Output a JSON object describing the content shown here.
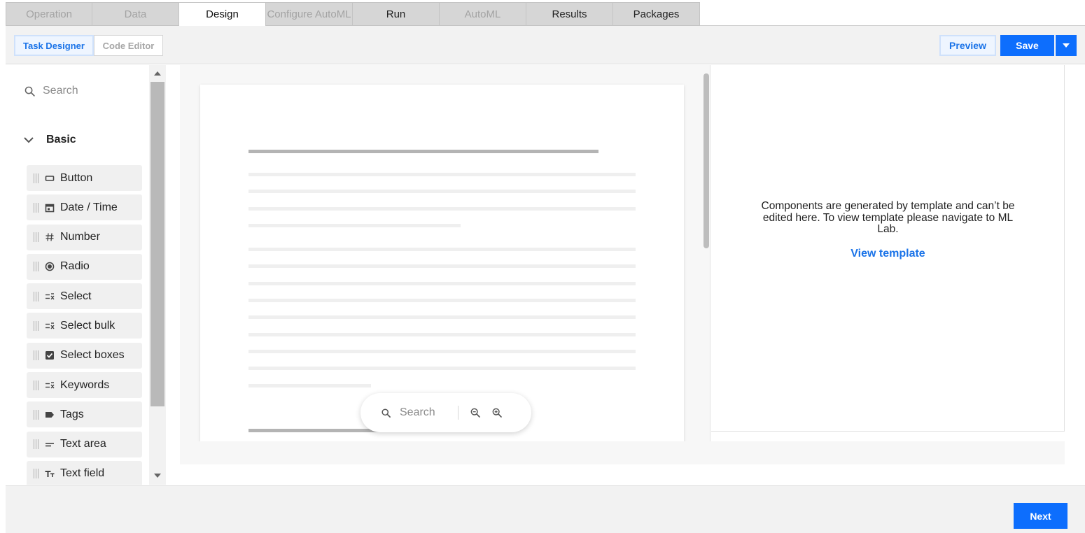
{
  "tabs": [
    {
      "label": "Operation",
      "state": "disabled"
    },
    {
      "label": "Data",
      "state": "disabled"
    },
    {
      "label": "Design",
      "state": "active"
    },
    {
      "label": "Configure AutoML",
      "state": "disabled"
    },
    {
      "label": "Run",
      "state": "normal"
    },
    {
      "label": "AutoML",
      "state": "disabled"
    },
    {
      "label": "Results",
      "state": "normal"
    },
    {
      "label": "Packages",
      "state": "normal"
    }
  ],
  "toolbar": {
    "task_designer_label": "Task Designer",
    "code_editor_label": "Code Editor",
    "preview_label": "Preview",
    "save_label": "Save"
  },
  "sidebar": {
    "search_placeholder": "Search",
    "group_label": "Basic",
    "items": [
      {
        "label": "Button",
        "icon": "button-icon"
      },
      {
        "label": "Date / Time",
        "icon": "calendar-icon"
      },
      {
        "label": "Number",
        "icon": "hash-icon"
      },
      {
        "label": "Radio",
        "icon": "radio-icon"
      },
      {
        "label": "Select",
        "icon": "select-icon"
      },
      {
        "label": "Select bulk",
        "icon": "select-icon"
      },
      {
        "label": "Select boxes",
        "icon": "checkbox-icon"
      },
      {
        "label": "Keywords",
        "icon": "select-icon"
      },
      {
        "label": "Tags",
        "icon": "tag-icon"
      },
      {
        "label": "Text area",
        "icon": "text-area-icon"
      },
      {
        "label": "Text field",
        "icon": "text-field-icon"
      }
    ]
  },
  "canvas": {
    "search_label": "Search"
  },
  "info": {
    "message": "Components are generated by template and can’t be edited here. To view template please navigate to ML Lab.",
    "link_label": "View template"
  },
  "footer": {
    "next_label": "Next"
  },
  "colors": {
    "accent": "#0d6efd",
    "link": "#1a73e8"
  }
}
